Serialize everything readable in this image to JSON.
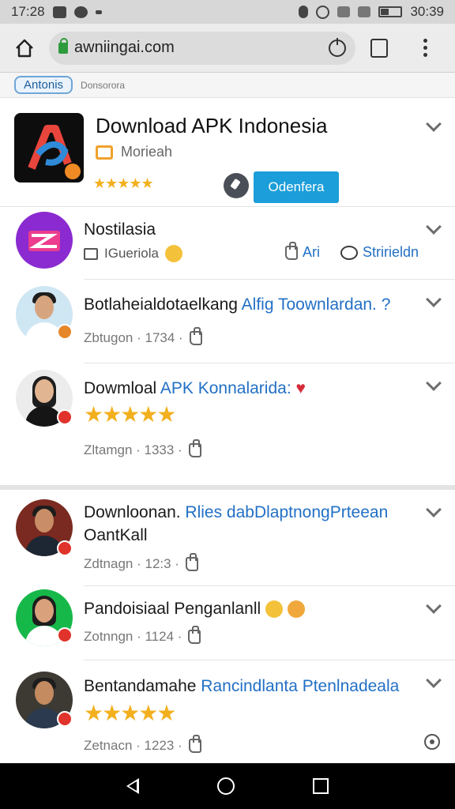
{
  "status_bar": {
    "time": "17:28",
    "clock_right": "30:39"
  },
  "browser": {
    "url": "awniingai.com",
    "tab_count": ""
  },
  "subbar": {
    "chip": "Antonis",
    "text": "Donsorora"
  },
  "app": {
    "title": "Download APK Indonesia",
    "subtitle": "Morieah",
    "stars": "★★★★★",
    "button": "Odenfera"
  },
  "items": [
    {
      "title": "Nostilasia",
      "meta": "IGueriola",
      "action_like": "Ari",
      "action_comment": "Stririeldn"
    },
    {
      "title_a": "Botlaheialdotaelkang ",
      "title_b": "Alfig Toownlardan. ?",
      "meta": "Zbtugon · 1734 ·"
    },
    {
      "title_a": "Dowmloal ",
      "title_b": "APK Konnalarida: ",
      "heart": "♥",
      "stars": "★★★★★",
      "meta": "Zltamgn · 1333 ·"
    },
    {
      "title_a": "Downloonan. ",
      "title_b": "Rlies dabDlaptnongPrteean",
      "title_c": "OantKall",
      "meta": "Zdtnagn · 12:3 ·"
    },
    {
      "title_a": "Pandoisiaal Penganlanll",
      "meta": "Zotnngn · 1124 ·"
    },
    {
      "title_a": "Bentandamahe ",
      "title_b": "Rancindlanta Ptenlnadeala",
      "stars": "★★★★★",
      "meta": "Zetnacn · 1223 ·"
    }
  ],
  "colors": {
    "accent": "#1b9ed9",
    "link": "#2270c5",
    "star": "#f2b01e",
    "nav": "#000000"
  }
}
